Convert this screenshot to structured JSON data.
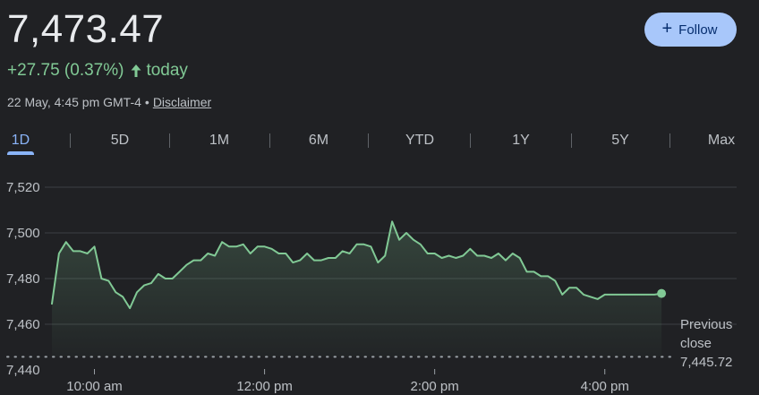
{
  "quote": {
    "price": "7,473.47",
    "change": "+27.75 (0.37%)",
    "change_period": "today",
    "timestamp": "22 May, 4:45 pm GMT-4",
    "separator": "•",
    "disclaimer": "Disclaimer"
  },
  "follow": {
    "label": "Follow",
    "icon": "plus-icon"
  },
  "tabs": [
    "1D",
    "5D",
    "1M",
    "6M",
    "YTD",
    "1Y",
    "5Y",
    "Max"
  ],
  "active_tab": "1D",
  "previous_close": {
    "label_line1": "Previous",
    "label_line2": "close",
    "value": "7,445.72"
  },
  "colors": {
    "background": "#202124",
    "line": "#81c995",
    "accent": "#8ab4f8",
    "follow_bg": "#a8c7fa",
    "grid": "#3c4043"
  },
  "chart_data": {
    "type": "line",
    "x_unit": "minutes since midnight",
    "ylim": [
      7440,
      7520
    ],
    "yticks": [
      7520,
      7500,
      7480,
      7460,
      7440
    ],
    "ytick_labels": [
      "7,520",
      "7,500",
      "7,480",
      "7,460",
      "7,440"
    ],
    "xticks": [
      600,
      720,
      840,
      960
    ],
    "xtick_labels": [
      "10:00 am",
      "12:00 pm",
      "2:00 pm",
      "4:00 pm"
    ],
    "xlim": [
      570,
      1005
    ],
    "previous_close": 7445.72,
    "grid": true,
    "series": [
      {
        "x": [
          570,
          575,
          580,
          585,
          590,
          595,
          600,
          605,
          610,
          615,
          620,
          625,
          630,
          635,
          640,
          645,
          650,
          655,
          660,
          665,
          670,
          675,
          680,
          685,
          690,
          695,
          700,
          705,
          710,
          715,
          720,
          725,
          730,
          735,
          740,
          745,
          750,
          755,
          760,
          765,
          770,
          775,
          780,
          785,
          790,
          795,
          800,
          805,
          810,
          815,
          820,
          825,
          830,
          835,
          840,
          845,
          850,
          855,
          860,
          865,
          870,
          875,
          880,
          885,
          890,
          895,
          900,
          905,
          910,
          915,
          920,
          925,
          930,
          935,
          940,
          945,
          950,
          955,
          960,
          965,
          970,
          975,
          980,
          985,
          990,
          995,
          1000
        ],
        "y": [
          7469,
          7491,
          7496,
          7492,
          7492,
          7491,
          7494,
          7480,
          7479,
          7474,
          7472,
          7467,
          7474,
          7477,
          7478,
          7482,
          7480,
          7480,
          7483,
          7486,
          7488,
          7488,
          7491,
          7490,
          7496,
          7494,
          7494,
          7495,
          7491,
          7494,
          7494,
          7493,
          7491,
          7491,
          7487,
          7488,
          7491,
          7488,
          7488,
          7489,
          7489,
          7492,
          7491,
          7495,
          7495,
          7494,
          7487,
          7490,
          7505,
          7497,
          7500,
          7497,
          7495,
          7491,
          7491,
          7489,
          7490,
          7489,
          7490,
          7493,
          7490,
          7490,
          7489,
          7491,
          7488,
          7491,
          7489,
          7483,
          7483,
          7481,
          7481,
          7479,
          7473,
          7476,
          7476,
          7473,
          7472,
          7471,
          7473,
          7473,
          7473,
          7473,
          7473,
          7473,
          7473,
          7473,
          7473.47
        ]
      }
    ]
  }
}
